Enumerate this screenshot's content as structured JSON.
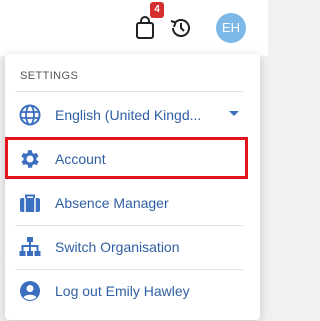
{
  "header": {
    "cart_badge": "4",
    "avatar_initials": "EH"
  },
  "menu": {
    "section_title": "SETTINGS",
    "language": {
      "label": "English (United Kingd..."
    },
    "account": {
      "label": "Account"
    },
    "absence": {
      "label": "Absence Manager"
    },
    "switch_org": {
      "label": "Switch Organisation"
    },
    "logout": {
      "label": "Log out Emily Hawley"
    }
  },
  "colors": {
    "accent_text": "#2f5fa3",
    "icon_blue": "#3b6fc0",
    "badge_red": "#d32f2f",
    "highlight_red": "#e4151f",
    "avatar_bg": "#7cb9e8"
  }
}
